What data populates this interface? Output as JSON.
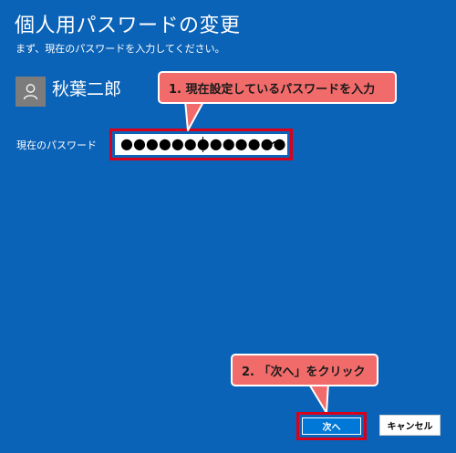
{
  "dialog": {
    "title": "個人用パスワードの変更",
    "subtitle": "まず、現在のパスワードを入力してください。"
  },
  "user": {
    "name": "秋葉二郎",
    "avatar_icon": "person-icon"
  },
  "password": {
    "label": "現在のパスワード",
    "masked_value": "●●●●●●●●●●●●●",
    "reveal_icon": "eye-icon"
  },
  "callouts": {
    "step1": "1. 現在設定しているパスワードを入力",
    "step2": "2. 「次へ」をクリック"
  },
  "buttons": {
    "next": "次へ",
    "cancel": "キャンセル"
  },
  "colors": {
    "background": "#0b63b7",
    "highlight": "#d9001b",
    "callout": "#f26b6b",
    "primary_button": "#0078d7"
  }
}
